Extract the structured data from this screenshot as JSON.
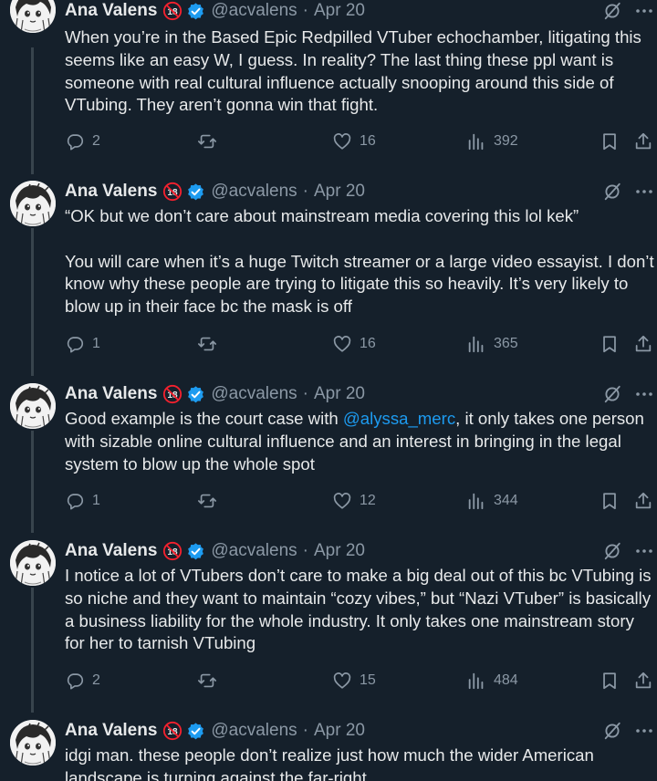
{
  "colors": {
    "background": "#15202b",
    "text": "#e7e9ea",
    "muted": "#8b98a5",
    "link": "#1d9bf0",
    "verified": "#1d9bf0",
    "thread_line": "#38444d",
    "badge_red": "#f4212e"
  },
  "icons": {
    "reply": "reply-icon",
    "retweet": "retweet-icon",
    "like": "heart-icon",
    "views": "views-icon",
    "bookmark": "bookmark-icon",
    "share": "share-icon",
    "grok": "grok-icon",
    "more": "more-icon",
    "verified": "verified-badge-icon",
    "age": "18-plus-icon"
  },
  "tweets": [
    {
      "name": "Ana Valens",
      "handle": "@acvalens",
      "separator": "·",
      "date": "Apr 20",
      "text": "When you’re in the Based Epic Redpilled VTuber echochamber, litigating this seems like an easy W, I guess. In reality? The last thing these ppl want is someone with real cultural influence actually snooping around this side of VTubing. They aren’t gonna win that fight.",
      "replies": "2",
      "retweets": "",
      "likes": "16",
      "views": "392"
    },
    {
      "name": "Ana Valens",
      "handle": "@acvalens",
      "separator": "·",
      "date": "Apr 20",
      "text": "“OK but we don’t care about mainstream media covering this lol kek”\n\nYou will care when it’s a huge Twitch streamer or a large video essayist. I don’t know why these people are trying to litigate this so heavily. It’s very likely to blow up in their face bc the mask is off",
      "replies": "1",
      "retweets": "",
      "likes": "16",
      "views": "365"
    },
    {
      "name": "Ana Valens",
      "handle": "@acvalens",
      "separator": "·",
      "date": "Apr 20",
      "text_before": "Good example is the court case with ",
      "mention": "@alyssa_merc",
      "text_after": ", it only takes one person with sizable online cultural influence and an interest in bringing in the legal system to blow up the whole spot",
      "replies": "1",
      "retweets": "",
      "likes": "12",
      "views": "344"
    },
    {
      "name": "Ana Valens",
      "handle": "@acvalens",
      "separator": "·",
      "date": "Apr 20",
      "text": "I notice a lot of VTubers don’t care to make a big deal out of this bc VTubing is so niche and they want to maintain “cozy vibes,” but “Nazi VTuber” is basically a business liability for the whole industry. It only takes one mainstream story for her to tarnish VTubing",
      "replies": "2",
      "retweets": "",
      "likes": "15",
      "views": "484"
    },
    {
      "name": "Ana Valens",
      "handle": "@acvalens",
      "separator": "·",
      "date": "Apr 20",
      "text": "idgi man. these people don’t realize just how much the wider American landscape is turning against the far-right"
    }
  ]
}
